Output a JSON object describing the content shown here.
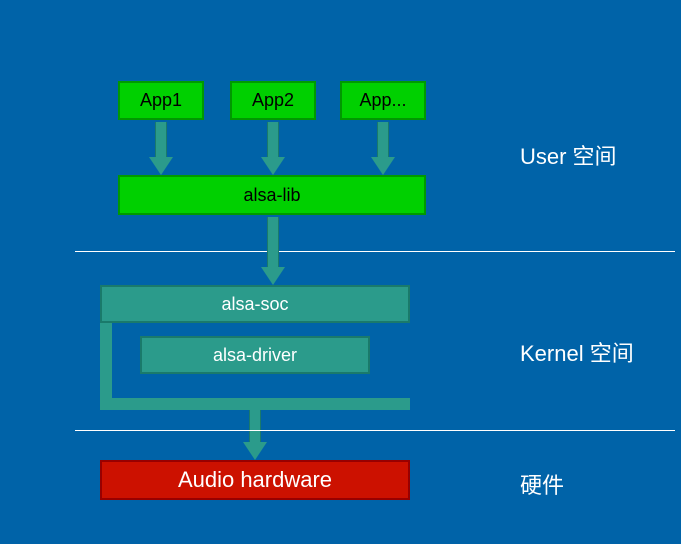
{
  "apps": {
    "app1": "App1",
    "app2": "App2",
    "app3": "App..."
  },
  "alsa_lib": "alsa-lib",
  "alsa_soc": "alsa-soc",
  "alsa_driver": "alsa-driver",
  "audio_hardware": "Audio hardware",
  "labels": {
    "user_space": "User 空间",
    "kernel_space": "Kernel 空间",
    "hardware": "硬件"
  }
}
